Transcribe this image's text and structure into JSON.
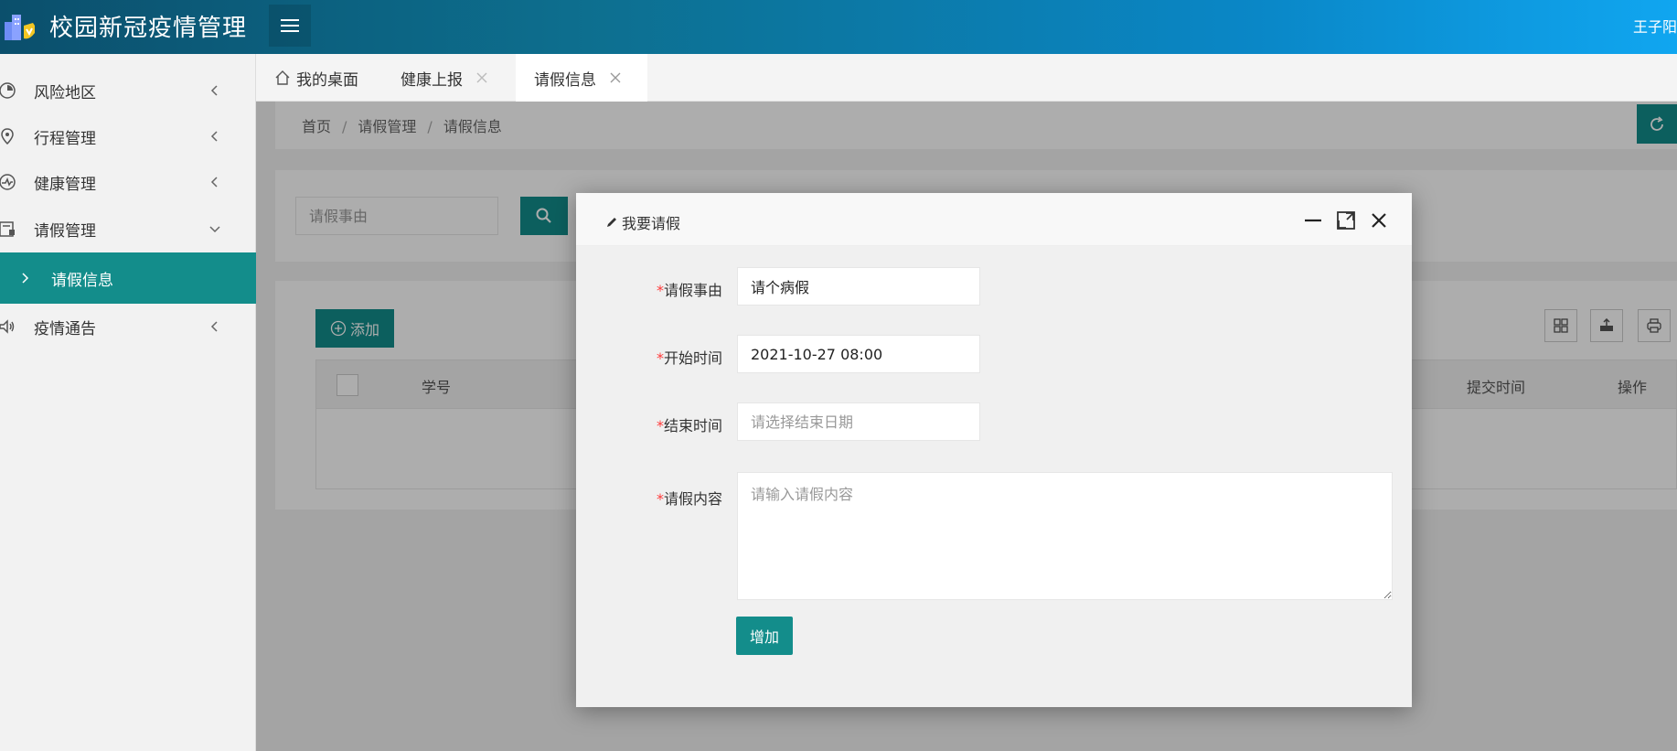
{
  "header": {
    "app_title": "校园新冠疫情管理",
    "user_name": "王子阳",
    "logo_icon": "building-shield-icon",
    "menu_icon": "hamburger-icon"
  },
  "sidebar": {
    "items": [
      {
        "label": "风险地区",
        "icon": "map-risk-icon",
        "expanded": false
      },
      {
        "label": "行程管理",
        "icon": "location-pin-icon",
        "expanded": false
      },
      {
        "label": "健康管理",
        "icon": "heartbeat-icon",
        "expanded": false
      },
      {
        "label": "请假管理",
        "icon": "form-icon",
        "expanded": true
      },
      {
        "label": "请假信息",
        "icon": "chevron-right-icon",
        "selected": true
      },
      {
        "label": "疫情通告",
        "icon": "speaker-icon",
        "expanded": false
      }
    ]
  },
  "tabs": [
    {
      "label": "我的桌面",
      "icon": "home-icon",
      "closable": false
    },
    {
      "label": "健康上报",
      "closable": true
    },
    {
      "label": "请假信息",
      "closable": true,
      "active": true
    }
  ],
  "breadcrumb": [
    "首页",
    "请假管理",
    "请假信息"
  ],
  "search": {
    "placeholder": "请假事由"
  },
  "table": {
    "add_label": "添加",
    "columns": [
      "学号",
      "提交时间",
      "操作"
    ],
    "toolbar_icons": [
      "columns-icon",
      "export-icon",
      "print-icon"
    ]
  },
  "modal": {
    "title": "我要请假",
    "fields": {
      "reason": {
        "label": "请假事由",
        "value": "请个病假"
      },
      "start": {
        "label": "开始时间",
        "value": "2021-10-27 08:00"
      },
      "end": {
        "label": "结束时间",
        "placeholder": "请选择结束日期"
      },
      "content": {
        "label": "请假内容",
        "placeholder": "请输入请假内容"
      }
    },
    "submit_label": "增加"
  },
  "colors": {
    "accent": "#138d8b",
    "required": "#ff3b3b"
  }
}
